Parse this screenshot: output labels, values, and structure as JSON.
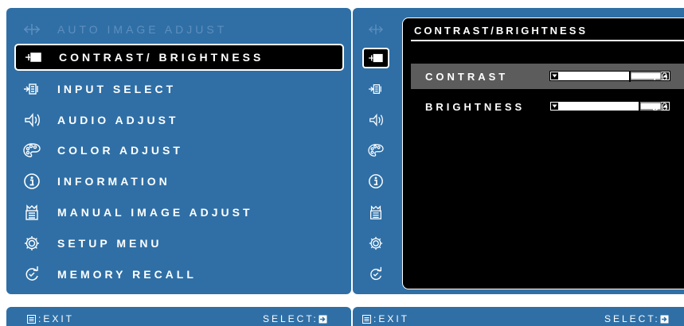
{
  "menu": {
    "items": [
      {
        "label": "AUTO IMAGE ADJUST",
        "icon": "auto-adjust-icon",
        "state": "disabled"
      },
      {
        "label": "CONTRAST/ BRIGHTNESS",
        "icon": "contrast-brightness-icon",
        "state": "selected"
      },
      {
        "label": "INPUT SELECT",
        "icon": "input-select-icon",
        "state": "normal"
      },
      {
        "label": "AUDIO ADJUST",
        "icon": "audio-icon",
        "state": "normal"
      },
      {
        "label": "COLOR ADJUST",
        "icon": "color-palette-icon",
        "state": "normal"
      },
      {
        "label": "INFORMATION",
        "icon": "info-icon",
        "state": "normal"
      },
      {
        "label": "MANUAL IMAGE ADJUST",
        "icon": "manual-adjust-icon",
        "state": "normal"
      },
      {
        "label": "SETUP MENU",
        "icon": "gear-icon",
        "state": "normal"
      },
      {
        "label": "MEMORY RECALL",
        "icon": "memory-recall-icon",
        "state": "normal"
      }
    ]
  },
  "submenu": {
    "title": "CONTRAST/BRIGHTNESS",
    "contrast": {
      "label": "CONTRAST",
      "value": "70",
      "level": 0.7
    },
    "brightness": {
      "label": "BRIGHTNESS",
      "value": "80",
      "level": 0.8
    }
  },
  "footer": {
    "left": {
      "exit": ":EXIT",
      "select": "SELECT:"
    },
    "right": {
      "exit": ":EXIT",
      "select": "SELECT:"
    }
  },
  "colors": {
    "panel": "#2f6fa6",
    "selected": "#000000",
    "highlight": "#5c5c5c",
    "disabled_text": "#5e8fbd"
  }
}
